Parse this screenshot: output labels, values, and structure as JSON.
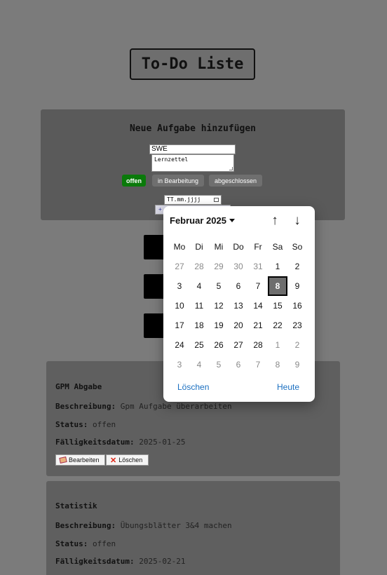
{
  "app": {
    "title": "To-Do Liste"
  },
  "add_form": {
    "heading": "Neue Aufgabe hinzufügen",
    "name_value": "SWE",
    "description_value": "Lernzettel",
    "status_buttons": [
      "offen",
      "in Bearbeitung",
      "abgeschlossen"
    ],
    "active_status": "offen",
    "date_placeholder": "TT.mm.jjjj",
    "add_button_label": "+"
  },
  "labels": {
    "description": "Beschreibung:",
    "status": "Status:",
    "due_date": "Fälligkeitsdatum:"
  },
  "tasks": [
    {
      "title": "GPM Abgabe",
      "description": "Gpm Aufgabe überarbeiten",
      "status": "offen",
      "due_date": "2025-01-25",
      "edit_label": "Bearbeiten",
      "delete_label": "Löschen"
    },
    {
      "title": "Statistik",
      "description": "Übungsblätter 3&4 machen",
      "status": "offen",
      "due_date": "2025-02-21"
    }
  ],
  "calendar": {
    "month_label": "Februar 2025",
    "weekdays": [
      "Mo",
      "Di",
      "Mi",
      "Do",
      "Fr",
      "Sa",
      "So"
    ],
    "weeks": [
      [
        "27",
        "28",
        "29",
        "30",
        "31",
        "1",
        "2"
      ],
      [
        "3",
        "4",
        "5",
        "6",
        "7",
        "8",
        "9"
      ],
      [
        "10",
        "11",
        "12",
        "13",
        "14",
        "15",
        "16"
      ],
      [
        "17",
        "18",
        "19",
        "20",
        "21",
        "22",
        "23"
      ],
      [
        "24",
        "25",
        "26",
        "27",
        "28",
        "1",
        "2"
      ],
      [
        "3",
        "4",
        "5",
        "6",
        "7",
        "8",
        "9"
      ]
    ],
    "selected_day": "8",
    "clear_label": "Löschen",
    "today_label": "Heute",
    "colors": {
      "selected_bg": "#6e6e6e",
      "link": "#1a6fc0",
      "other_month": "#8a8a8a"
    }
  },
  "colors": {
    "status_open": "#0a7a0a",
    "page_overlay": "#7b7b7b"
  }
}
